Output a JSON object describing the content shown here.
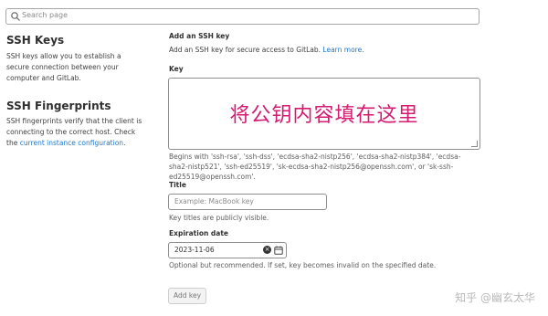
{
  "search": {
    "placeholder": "Search page"
  },
  "sidebar": {
    "keys_title": "SSH Keys",
    "keys_desc": "SSH keys allow you to establish a secure connection between your computer and GitLab.",
    "fingerprints_title": "SSH Fingerprints",
    "fingerprints_desc": "SSH fingerprints verify that the client is connecting to the correct host. Check the ",
    "fingerprints_link": "current instance configuration",
    "fingerprints_period": "."
  },
  "form": {
    "heading": "Add an SSH key",
    "subtext": "Add an SSH key for secure access to GitLab. ",
    "learn_more": "Learn more.",
    "key_label": "Key",
    "key_overlay": "将公钥内容填在这里",
    "key_hint": "Begins with 'ssh-rsa', 'ssh-dss', 'ecdsa-sha2-nistp256', 'ecdsa-sha2-nistp384', 'ecdsa-sha2-nistp521', 'ssh-ed25519', 'sk-ecdsa-sha2-nistp256@openssh.com', or 'sk-ssh-ed25519@openssh.com'.",
    "title_label": "Title",
    "title_placeholder": "Example: MacBook key",
    "title_hint": "Key titles are publicly visible.",
    "expiry_label": "Expiration date",
    "expiry_value": "2023-11-06",
    "expiry_hint": "Optional but recommended. If set, key becomes invalid on the specified date.",
    "add_button": "Add key"
  },
  "watermark": "知乎 @幽玄太华"
}
